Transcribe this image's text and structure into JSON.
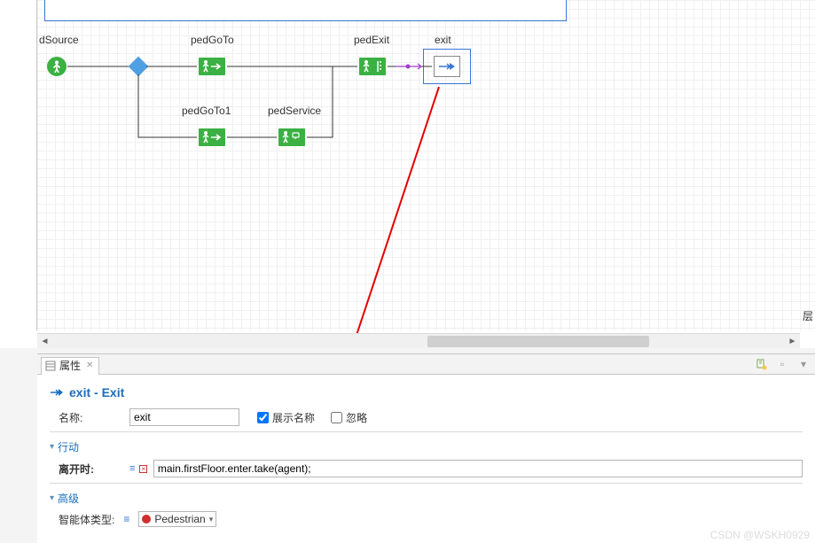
{
  "canvas": {
    "source_label": "dSource",
    "nodes": {
      "pedGoTo": "pedGoTo",
      "pedGoTo1": "pedGoTo1",
      "pedService": "pedService",
      "pedExit": "pedExit",
      "exit": "exit"
    },
    "side_char": "层"
  },
  "properties": {
    "tab_label": "属性",
    "heading": "exit - Exit",
    "fields": {
      "name_label": "名称:",
      "name_value": "exit",
      "show_name_label": "展示名称",
      "show_name_checked": true,
      "ignore_label": "忽略",
      "ignore_checked": false
    },
    "section_action": "行动",
    "on_leave_label": "离开时:",
    "on_leave_code": "main.firstFloor.enter.take(agent);",
    "section_advanced": "高级",
    "agent_type_label": "智能体类型:",
    "agent_type_value": "Pedestrian"
  },
  "watermark": "CSDN @WSKH0929"
}
